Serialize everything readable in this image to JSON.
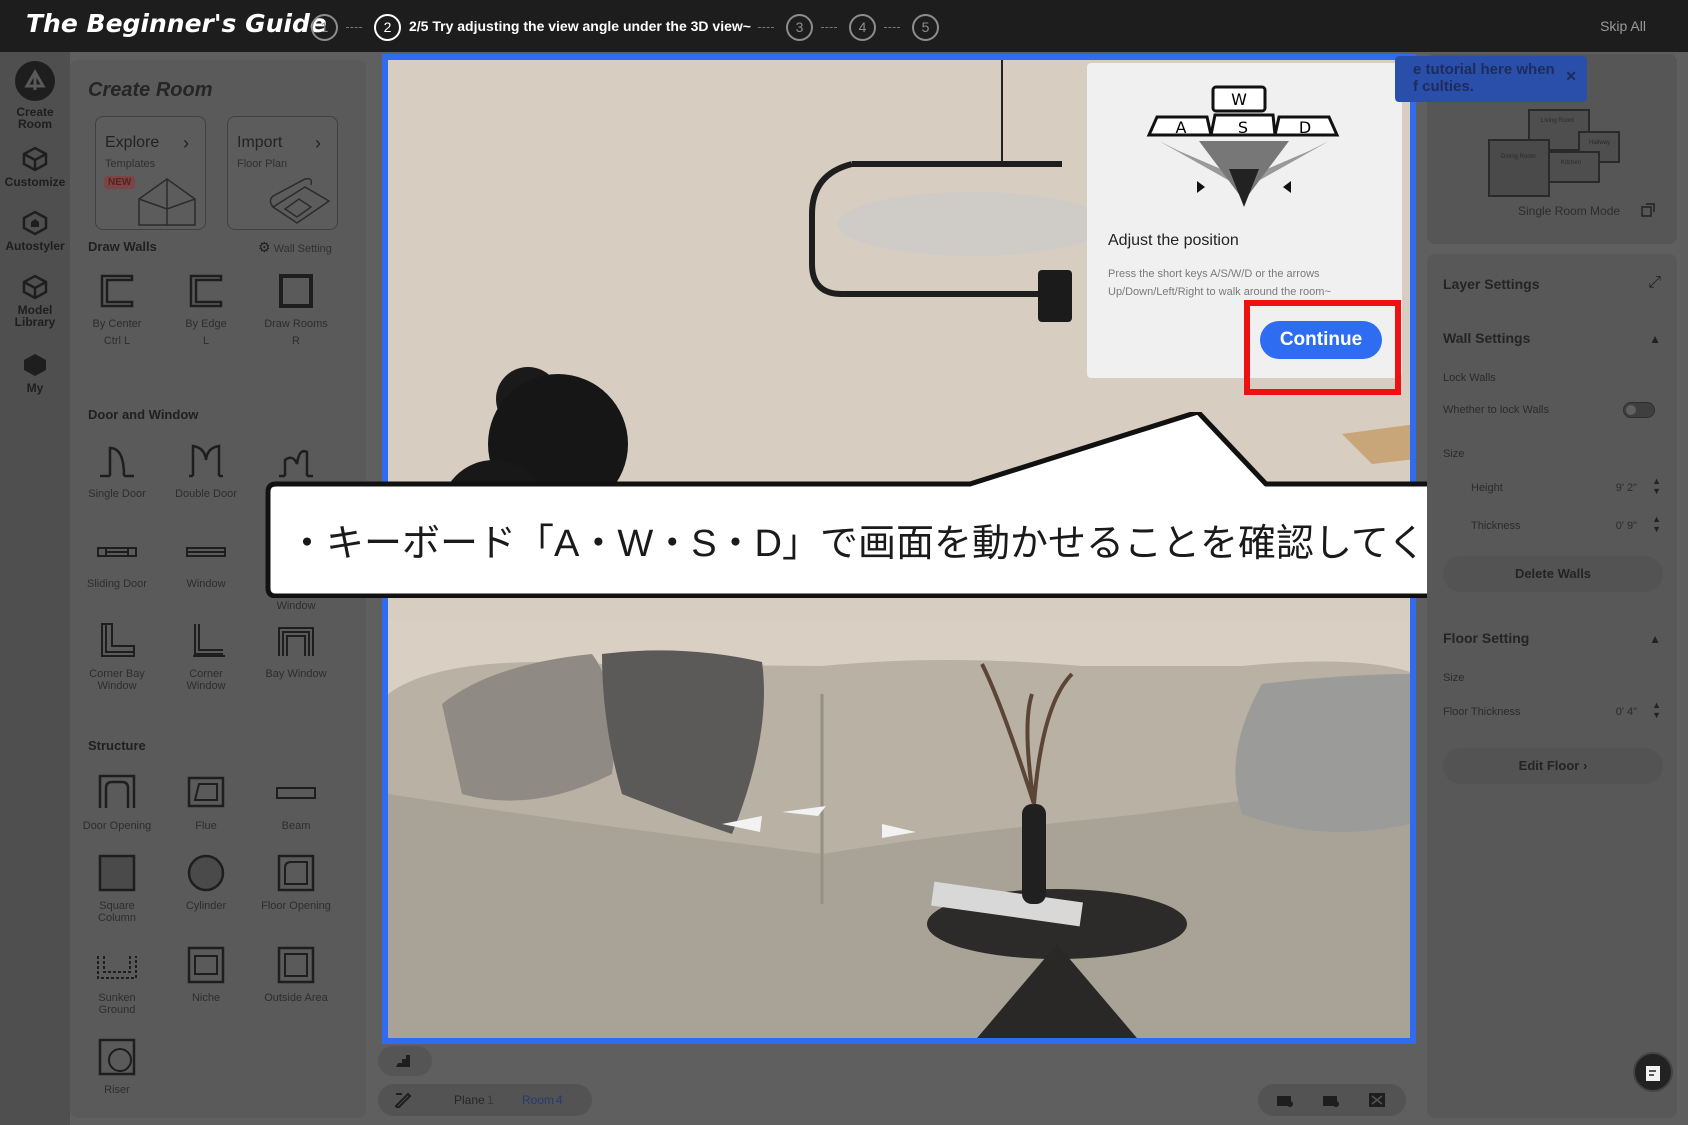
{
  "guide": {
    "title": "The Beginner's Guide",
    "steps": [
      "1",
      "2",
      "3",
      "4",
      "5"
    ],
    "current_step_label": "2/5 Try adjusting the view angle under the 3D view~",
    "skip_label": "Skip All"
  },
  "rail": {
    "items": [
      {
        "label_line1": "Create",
        "label_line2": "Room",
        "icon": "create-room-icon"
      },
      {
        "label_line1": "Customize",
        "label_line2": "",
        "icon": "customize-icon"
      },
      {
        "label_line1": "Autostyler",
        "label_line2": "",
        "icon": "autostyler-icon"
      },
      {
        "label_line1": "Model",
        "label_line2": "Library",
        "icon": "model-library-icon"
      },
      {
        "label_line1": "My",
        "label_line2": "",
        "icon": "my-icon"
      }
    ]
  },
  "left_panel": {
    "title": "Create Room",
    "cards": [
      {
        "title": "Explore",
        "sub": "Templates",
        "badge": "NEW"
      },
      {
        "title": "Import",
        "sub": "Floor Plan",
        "badge": ""
      }
    ],
    "draw_walls": {
      "heading": "Draw Walls",
      "wall_setting": "Wall Setting",
      "tools": [
        {
          "label": "By Center",
          "shortcut": "Ctrl L"
        },
        {
          "label": "By Edge",
          "shortcut": "L"
        },
        {
          "label": "Draw Rooms",
          "shortcut": "R"
        }
      ]
    },
    "door_window": {
      "heading": "Door and Window",
      "tools": [
        {
          "label": "Single Door",
          "label2": ""
        },
        {
          "label": "Double Door",
          "label2": ""
        },
        {
          "label": "Sliding Door",
          "label2": ""
        },
        {
          "label": "Window",
          "label2": ""
        },
        {
          "label": "Window",
          "label2": ""
        },
        {
          "label": "Corner Bay",
          "label2": "Window"
        },
        {
          "label": "Corner",
          "label2": "Window"
        },
        {
          "label": "Bay Window",
          "label2": ""
        }
      ]
    },
    "structure": {
      "heading": "Structure",
      "tools": [
        {
          "label": "Door Opening",
          "label2": ""
        },
        {
          "label": "Flue",
          "label2": ""
        },
        {
          "label": "Beam",
          "label2": ""
        },
        {
          "label": "Square",
          "label2": "Column"
        },
        {
          "label": "Cylinder",
          "label2": ""
        },
        {
          "label": "Floor Opening",
          "label2": ""
        },
        {
          "label": "Sunken",
          "label2": "Ground"
        },
        {
          "label": "Niche",
          "label2": ""
        },
        {
          "label": "Outside Area",
          "label2": ""
        },
        {
          "label": "Riser",
          "label2": ""
        }
      ]
    }
  },
  "tooltip": {
    "keys": [
      "W",
      "A",
      "S",
      "D"
    ],
    "title": "Adjust the position",
    "body": "Press the short keys A/S/W/D or the arrows Up/Down/Left/Right to walk around the room~",
    "continue_label": "Continue"
  },
  "callout": {
    "text": "・キーボード「A・W・S・D」で画面を動かせることを確認してください"
  },
  "banner": {
    "text_line1": "e tutorial here when",
    "text_line2": "f culties.",
    "close": "✕"
  },
  "minimap": {
    "mode_label": "Single Room Mode",
    "rooms": [
      "Living Room",
      "Hallway",
      "Dining Room",
      "Kitchen"
    ]
  },
  "right_panel": {
    "layer_settings": "Layer Settings",
    "wall_settings": "Wall Settings",
    "lock_walls": "Lock Walls",
    "lock_walls_hint": "Whether to lock Walls",
    "size": "Size",
    "height_label": "Height",
    "height_value": "9' 2\"",
    "thickness_label": "Thickness",
    "thickness_value": "0' 9\"",
    "delete_walls": "Delete Walls",
    "floor_setting": "Floor Setting",
    "floor_size": "Size",
    "floor_thickness_label": "Floor Thickness",
    "floor_thickness_value": "0' 4\"",
    "edit_floor": "Edit Floor"
  },
  "bottom_bar": {
    "plane_label": "Plane",
    "plane_value": "1",
    "room_label": "Room",
    "room_value": "4"
  },
  "colors": {
    "accent": "#2e6cf1",
    "highlight": "#ee1111",
    "topbar": "#1d1d1d"
  }
}
